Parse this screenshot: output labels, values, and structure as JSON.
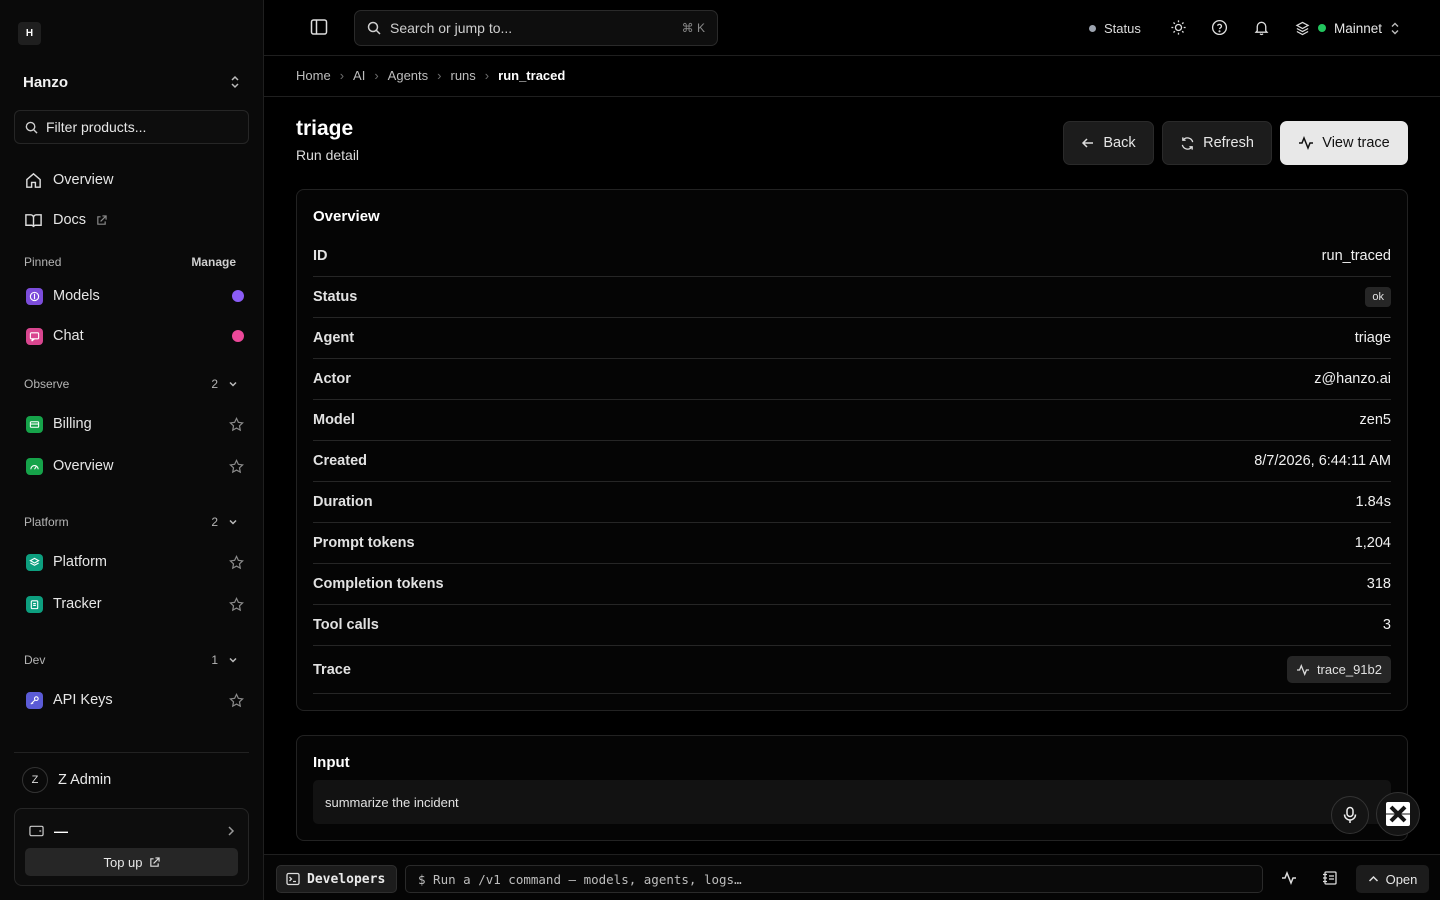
{
  "sidebar": {
    "logo": "H",
    "org_name": "Hanzo",
    "filter_placeholder": "Filter products...",
    "nav": [
      {
        "label": "Overview"
      },
      {
        "label": "Docs"
      }
    ],
    "pinned": {
      "title": "Pinned",
      "manage": "Manage",
      "items": [
        {
          "label": "Models",
          "color": "#8b5cf6"
        },
        {
          "label": "Chat",
          "color": "#ec4899"
        }
      ]
    },
    "observe": {
      "title": "Observe",
      "count": "2",
      "items": [
        {
          "label": "Billing"
        },
        {
          "label": "Overview"
        }
      ]
    },
    "platform": {
      "title": "Platform",
      "count": "2",
      "items": [
        {
          "label": "Platform"
        },
        {
          "label": "Tracker"
        }
      ]
    },
    "dev": {
      "title": "Dev",
      "count": "1",
      "items": [
        {
          "label": "API Keys"
        }
      ]
    },
    "user": {
      "initial": "Z",
      "name": "Z Admin"
    },
    "wallet": {
      "balance": "—",
      "topup": "Top up"
    }
  },
  "topbar": {
    "search_placeholder": "Search or jump to...",
    "shortcut": "⌘ K",
    "status_label": "Status",
    "network": "Mainnet"
  },
  "breadcrumb": [
    "Home",
    "AI",
    "Agents",
    "runs",
    "run_traced"
  ],
  "header": {
    "title": "triage",
    "subtitle": "Run detail",
    "back": "Back",
    "refresh": "Refresh",
    "view_trace": "View trace"
  },
  "overview": {
    "title": "Overview",
    "rows": [
      {
        "key": "ID",
        "value": "run_traced"
      },
      {
        "key": "Status",
        "value": "ok"
      },
      {
        "key": "Agent",
        "value": "triage"
      },
      {
        "key": "Actor",
        "value": "z@hanzo.ai"
      },
      {
        "key": "Model",
        "value": "zen5"
      },
      {
        "key": "Created",
        "value": "8/7/2026, 6:44:11 AM"
      },
      {
        "key": "Duration",
        "value": "1.84s"
      },
      {
        "key": "Prompt tokens",
        "value": "1,204"
      },
      {
        "key": "Completion tokens",
        "value": "318"
      },
      {
        "key": "Tool calls",
        "value": "3"
      },
      {
        "key": "Trace",
        "value": "trace_91b2"
      }
    ]
  },
  "input": {
    "title": "Input",
    "text": "summarize the incident"
  },
  "devbar": {
    "tab": "Developers",
    "placeholder": "$ Run a /v1 command — models, agents, logs…",
    "open": "Open"
  },
  "colors": {
    "accent_green": "#22c55e",
    "status_dot": "#9ca3af"
  }
}
